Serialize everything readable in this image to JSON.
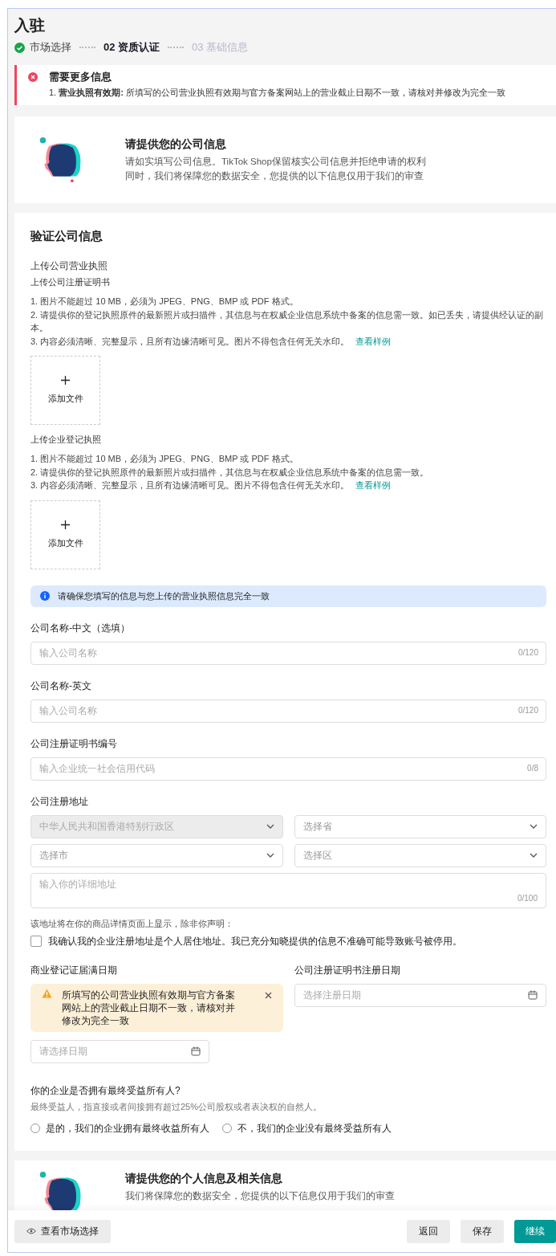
{
  "page": {
    "title": "入驻"
  },
  "steps": [
    {
      "label": "市场选择",
      "completed": true,
      "selected": false
    },
    {
      "number": "02",
      "label": "资质认证",
      "completed": false,
      "selected": true
    },
    {
      "number": "03",
      "label": "基础信息",
      "completed": false,
      "selected": false
    }
  ],
  "error_alert": {
    "title": "需要更多信息",
    "items": [
      "1. **营业执照有效期:** 所填写的公司营业执照有效期与官方备案网站上的营业截止日期不一致，请核对并修改为完全一致"
    ]
  },
  "intro_card": {
    "title": "请提供您的公司信息",
    "lines": [
      "请如实填写公司信息。TikTok Shop保留核实公司信息并拒绝申请的权利",
      "同时，我们将保障您的数据安全，您提供的以下信息仅用于我们的审查"
    ]
  },
  "verify_section": {
    "title": "验证公司信息",
    "upload_heading": "上传公司营业执照",
    "uploads": [
      {
        "label": "上传公司注册证明书",
        "rules": [
          "1. 图片不能超过 10 MB，必须为 JPEG、PNG、BMP 或 PDF 格式。",
          "2. 请提供你的登记执照原件的最新照片或扫描件，其信息与在权威企业信息系统中备案的信息需一致。如已丢失，请提供经认证的副本。",
          "3. 内容必须清晰、完整显示，且所有边缘清晰可见。图片不得包含任何无关水印。"
        ],
        "link": "查看样例",
        "button": "添加文件"
      },
      {
        "label": "上传企业登记执照",
        "rules": [
          "1. 图片不能超过 10 MB，必须为 JPEG、PNG、BMP 或 PDF 格式。",
          "2. 请提供你的登记执照原件的最新照片或扫描件，其信息与在权威企业信息系统中备案的信息需一致。",
          "3. 内容必须清晰、完整显示，且所有边缘清晰可见。图片不得包含任何无关水印。"
        ],
        "link": "查看样例",
        "button": "添加文件"
      }
    ]
  },
  "info_banner": "请确保您填写的信息与您上传的营业执照信息完全一致",
  "fields": [
    {
      "label": "公司名称-中文（选填）",
      "placeholder": "输入公司名称",
      "counter": "0/120"
    },
    {
      "label": "公司名称-英文",
      "placeholder": "输入公司名称",
      "counter": "0/120"
    },
    {
      "label": "公司注册证明书编号",
      "placeholder": "输入企业统一社会信用代码",
      "counter": "0/8"
    }
  ],
  "address": {
    "label": "公司注册地址",
    "selects": [
      {
        "text": "中华人民共和国香港特别行政区",
        "disabled": true
      },
      {
        "text": "选择省",
        "disabled": false
      },
      {
        "text": "选择市",
        "disabled": false
      },
      {
        "text": "选择区",
        "disabled": false
      }
    ],
    "detail": {
      "placeholder": "输入你的详细地址",
      "counter": "0/100"
    },
    "note": "该地址将在你的商品详情页面上显示，除非你声明：",
    "checkbox": {
      "label": "我确认我的企业注册地址是个人居住地址。我已充分知晓提供的信息不准确可能导致账号被停用。",
      "checked": false
    }
  },
  "dates": [
    {
      "label": "商业登记证届满日期",
      "warning": "所填写的公司营业执照有效期与官方备案网站上的营业截止日期不一致，请核对并修改为完全一致",
      "placeholder": "请选择日期"
    },
    {
      "label": "公司注册证明书注册日期",
      "placeholder": "选择注册日期"
    }
  ],
  "owner": {
    "question": "你的企业是否拥有最终受益所有人?",
    "hint": "最终受益人，指直接或者间接拥有超过25%公司股权或者表决权的自然人。",
    "options": [
      {
        "label": "是的，我们的企业拥有最终收益所有人",
        "selected": false
      },
      {
        "label": "不，我们的企业没有最终受益所有人",
        "selected": false
      }
    ]
  },
  "personal_card": {
    "title": "请提供您的个人信息及相关信息",
    "subtitle": "我们将保障您的数据安全，您提供的以下信息仅用于我们的审查"
  },
  "footer": {
    "view_button": "查看市场选择",
    "buttons": [
      {
        "label": "返回",
        "kind": "secondary"
      },
      {
        "label": "保存",
        "kind": "secondary"
      },
      {
        "label": "继续",
        "kind": "primary"
      }
    ]
  }
}
